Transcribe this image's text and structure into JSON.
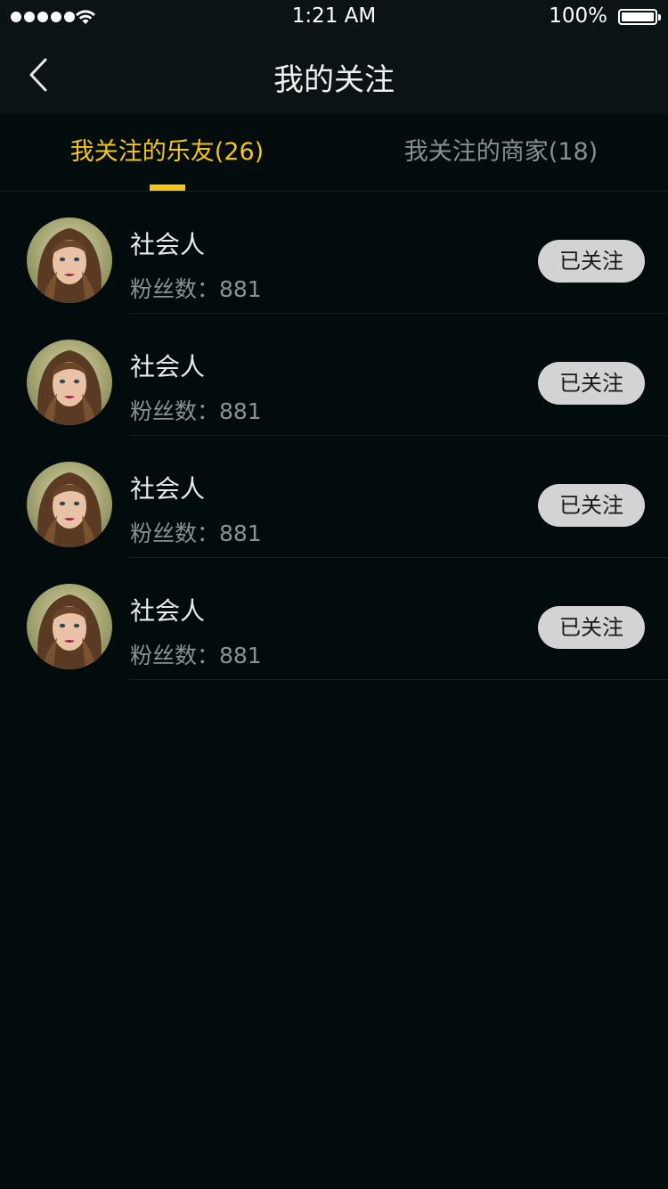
{
  "status_bar": {
    "time": "1:21 AM",
    "battery": "100%"
  },
  "nav": {
    "title": "我的关注",
    "back_icon": "chevron-left-icon"
  },
  "tabs": [
    {
      "label": "我关注的乐友(26)",
      "active": true
    },
    {
      "label": "我关注的商家(18)",
      "active": false
    }
  ],
  "colors": {
    "accent": "#f5c518",
    "background": "#020c0d",
    "button": "#d3d3d3"
  },
  "list": [
    {
      "name": "社会人",
      "fans": "粉丝数：881",
      "button": "已关注"
    },
    {
      "name": "社会人",
      "fans": "粉丝数：881",
      "button": "已关注"
    },
    {
      "name": "社会人",
      "fans": "粉丝数：881",
      "button": "已关注"
    },
    {
      "name": "社会人",
      "fans": "粉丝数：881",
      "button": "已关注"
    }
  ]
}
